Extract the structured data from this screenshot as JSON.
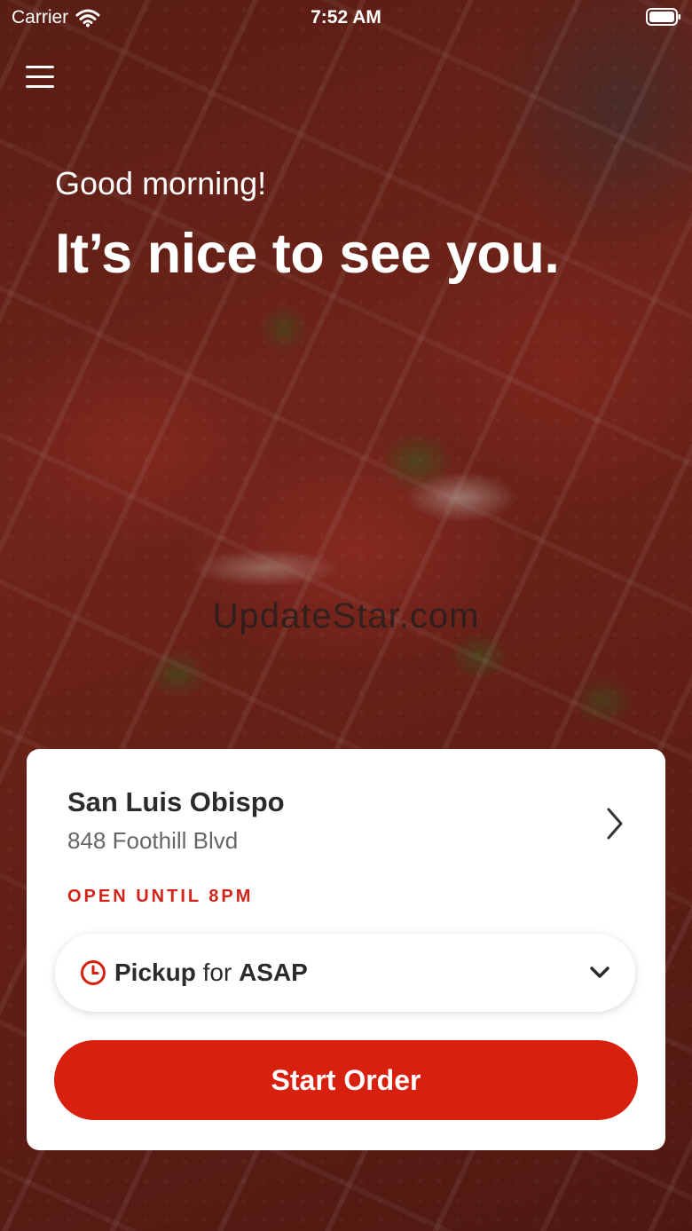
{
  "status_bar": {
    "carrier": "Carrier",
    "time": "7:52 AM"
  },
  "hero": {
    "greeting": "Good morning!",
    "headline": "It’s nice to see you."
  },
  "watermark": "UpdateStar.com",
  "store": {
    "name": "San Luis Obispo",
    "address": "848 Foothill Blvd",
    "hours": "OPEN UNTIL 8PM"
  },
  "order_type": {
    "mode": "Pickup",
    "connector": "for",
    "timing": "ASAP"
  },
  "actions": {
    "start_order": "Start Order"
  },
  "colors": {
    "accent": "#d8200f",
    "hours_text": "#d2241a",
    "text_dark": "#2b2b2b"
  },
  "icons": [
    "wifi-icon",
    "battery-icon",
    "hamburger-menu-icon",
    "chevron-right-icon",
    "clock-icon",
    "chevron-down-icon"
  ]
}
